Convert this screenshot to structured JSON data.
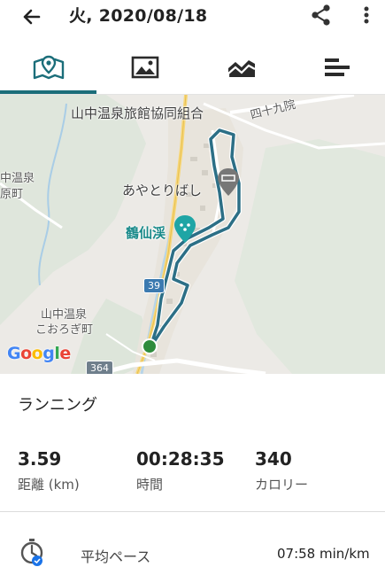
{
  "header": {
    "title": "火, 2020/08/18",
    "back_icon": "arrow-back-icon",
    "share_icon": "share-icon",
    "more_icon": "more-vert-icon"
  },
  "tabs": [
    {
      "name": "map",
      "icon": "map-pin-icon",
      "selected": true
    },
    {
      "name": "photos",
      "icon": "image-icon",
      "selected": false
    },
    {
      "name": "chart",
      "icon": "area-chart-icon",
      "selected": false
    },
    {
      "name": "details",
      "icon": "list-bars-icon",
      "selected": false
    }
  ],
  "colors": {
    "accent": "#1b6e7a",
    "route": "#2c6f86",
    "poi": "#1fa5a5",
    "start": "#2e8b3c"
  },
  "map": {
    "labels": {
      "onsen_association": "山中温泉旅館協同組合",
      "shijukuin": "四十九院",
      "ayatori_bridge": "あやとりばし",
      "kakusenkei": "鶴仙渓",
      "left_area_line1": "中温泉",
      "left_area_line2": "原町",
      "korogi_line1": "山中温泉",
      "korogi_line2": "こおろぎ町"
    },
    "road_shields": [
      "39",
      "364"
    ],
    "attribution": "Google"
  },
  "activity": {
    "type": "ランニング"
  },
  "stats": [
    {
      "value": "3.59",
      "label": "距離 (km)"
    },
    {
      "value": "00:28:35",
      "label": "時間"
    },
    {
      "value": "340",
      "label": "カロリー"
    }
  ],
  "pace": {
    "label": "平均ペース",
    "value": "07:58 min/km",
    "icon": "stopwatch-icon"
  }
}
